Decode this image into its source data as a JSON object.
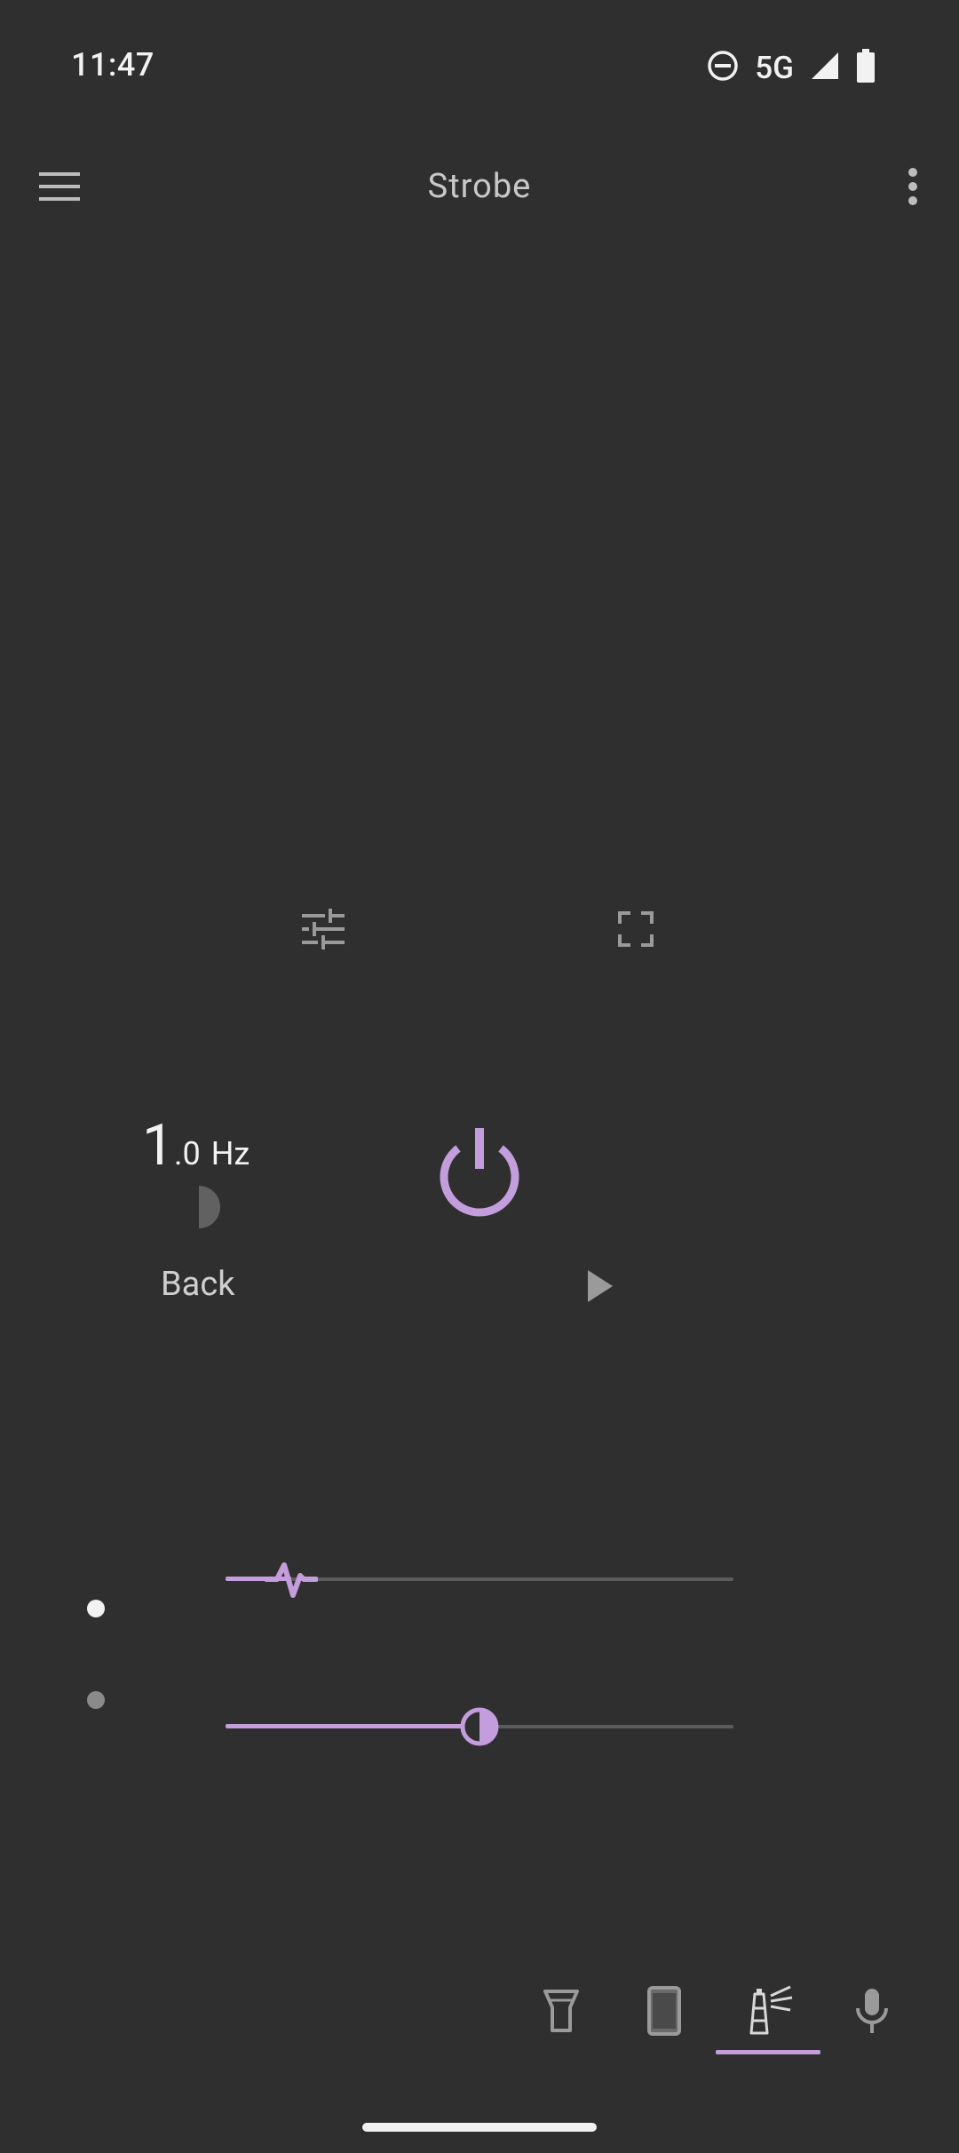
{
  "status_bar": {
    "time": "11:47",
    "network": "5G",
    "icons": [
      "do-not-disturb-icon",
      "signal-icon",
      "battery-icon"
    ]
  },
  "app_bar": {
    "title": "Strobe",
    "menu_icon": "hamburger-menu-icon",
    "more_icon": "more-vertical-icon"
  },
  "tools": {
    "settings_icon": "tune-icon",
    "fullscreen_icon": "fullscreen-icon"
  },
  "strobe": {
    "frequency_int": "1",
    "frequency_dec": ".0",
    "frequency_unit": "Hz",
    "mode_label": "Back",
    "power_icon": "power-icon",
    "play_icon": "play-icon"
  },
  "sliders": {
    "frequency_level": 0.13,
    "duty_level": 0.5
  },
  "tabs": [
    {
      "name": "flashlight",
      "icon": "flashlight-icon",
      "selected": false
    },
    {
      "name": "screen",
      "icon": "phone-screen-icon",
      "selected": false
    },
    {
      "name": "strobe",
      "icon": "lighthouse-icon",
      "selected": true
    },
    {
      "name": "sound",
      "icon": "microphone-icon",
      "selected": false
    }
  ],
  "colors": {
    "background": "#2f2f2f",
    "accent": "#c49ddd",
    "icon_gray": "#9a9a9a",
    "text_light": "#f2f2f2"
  }
}
